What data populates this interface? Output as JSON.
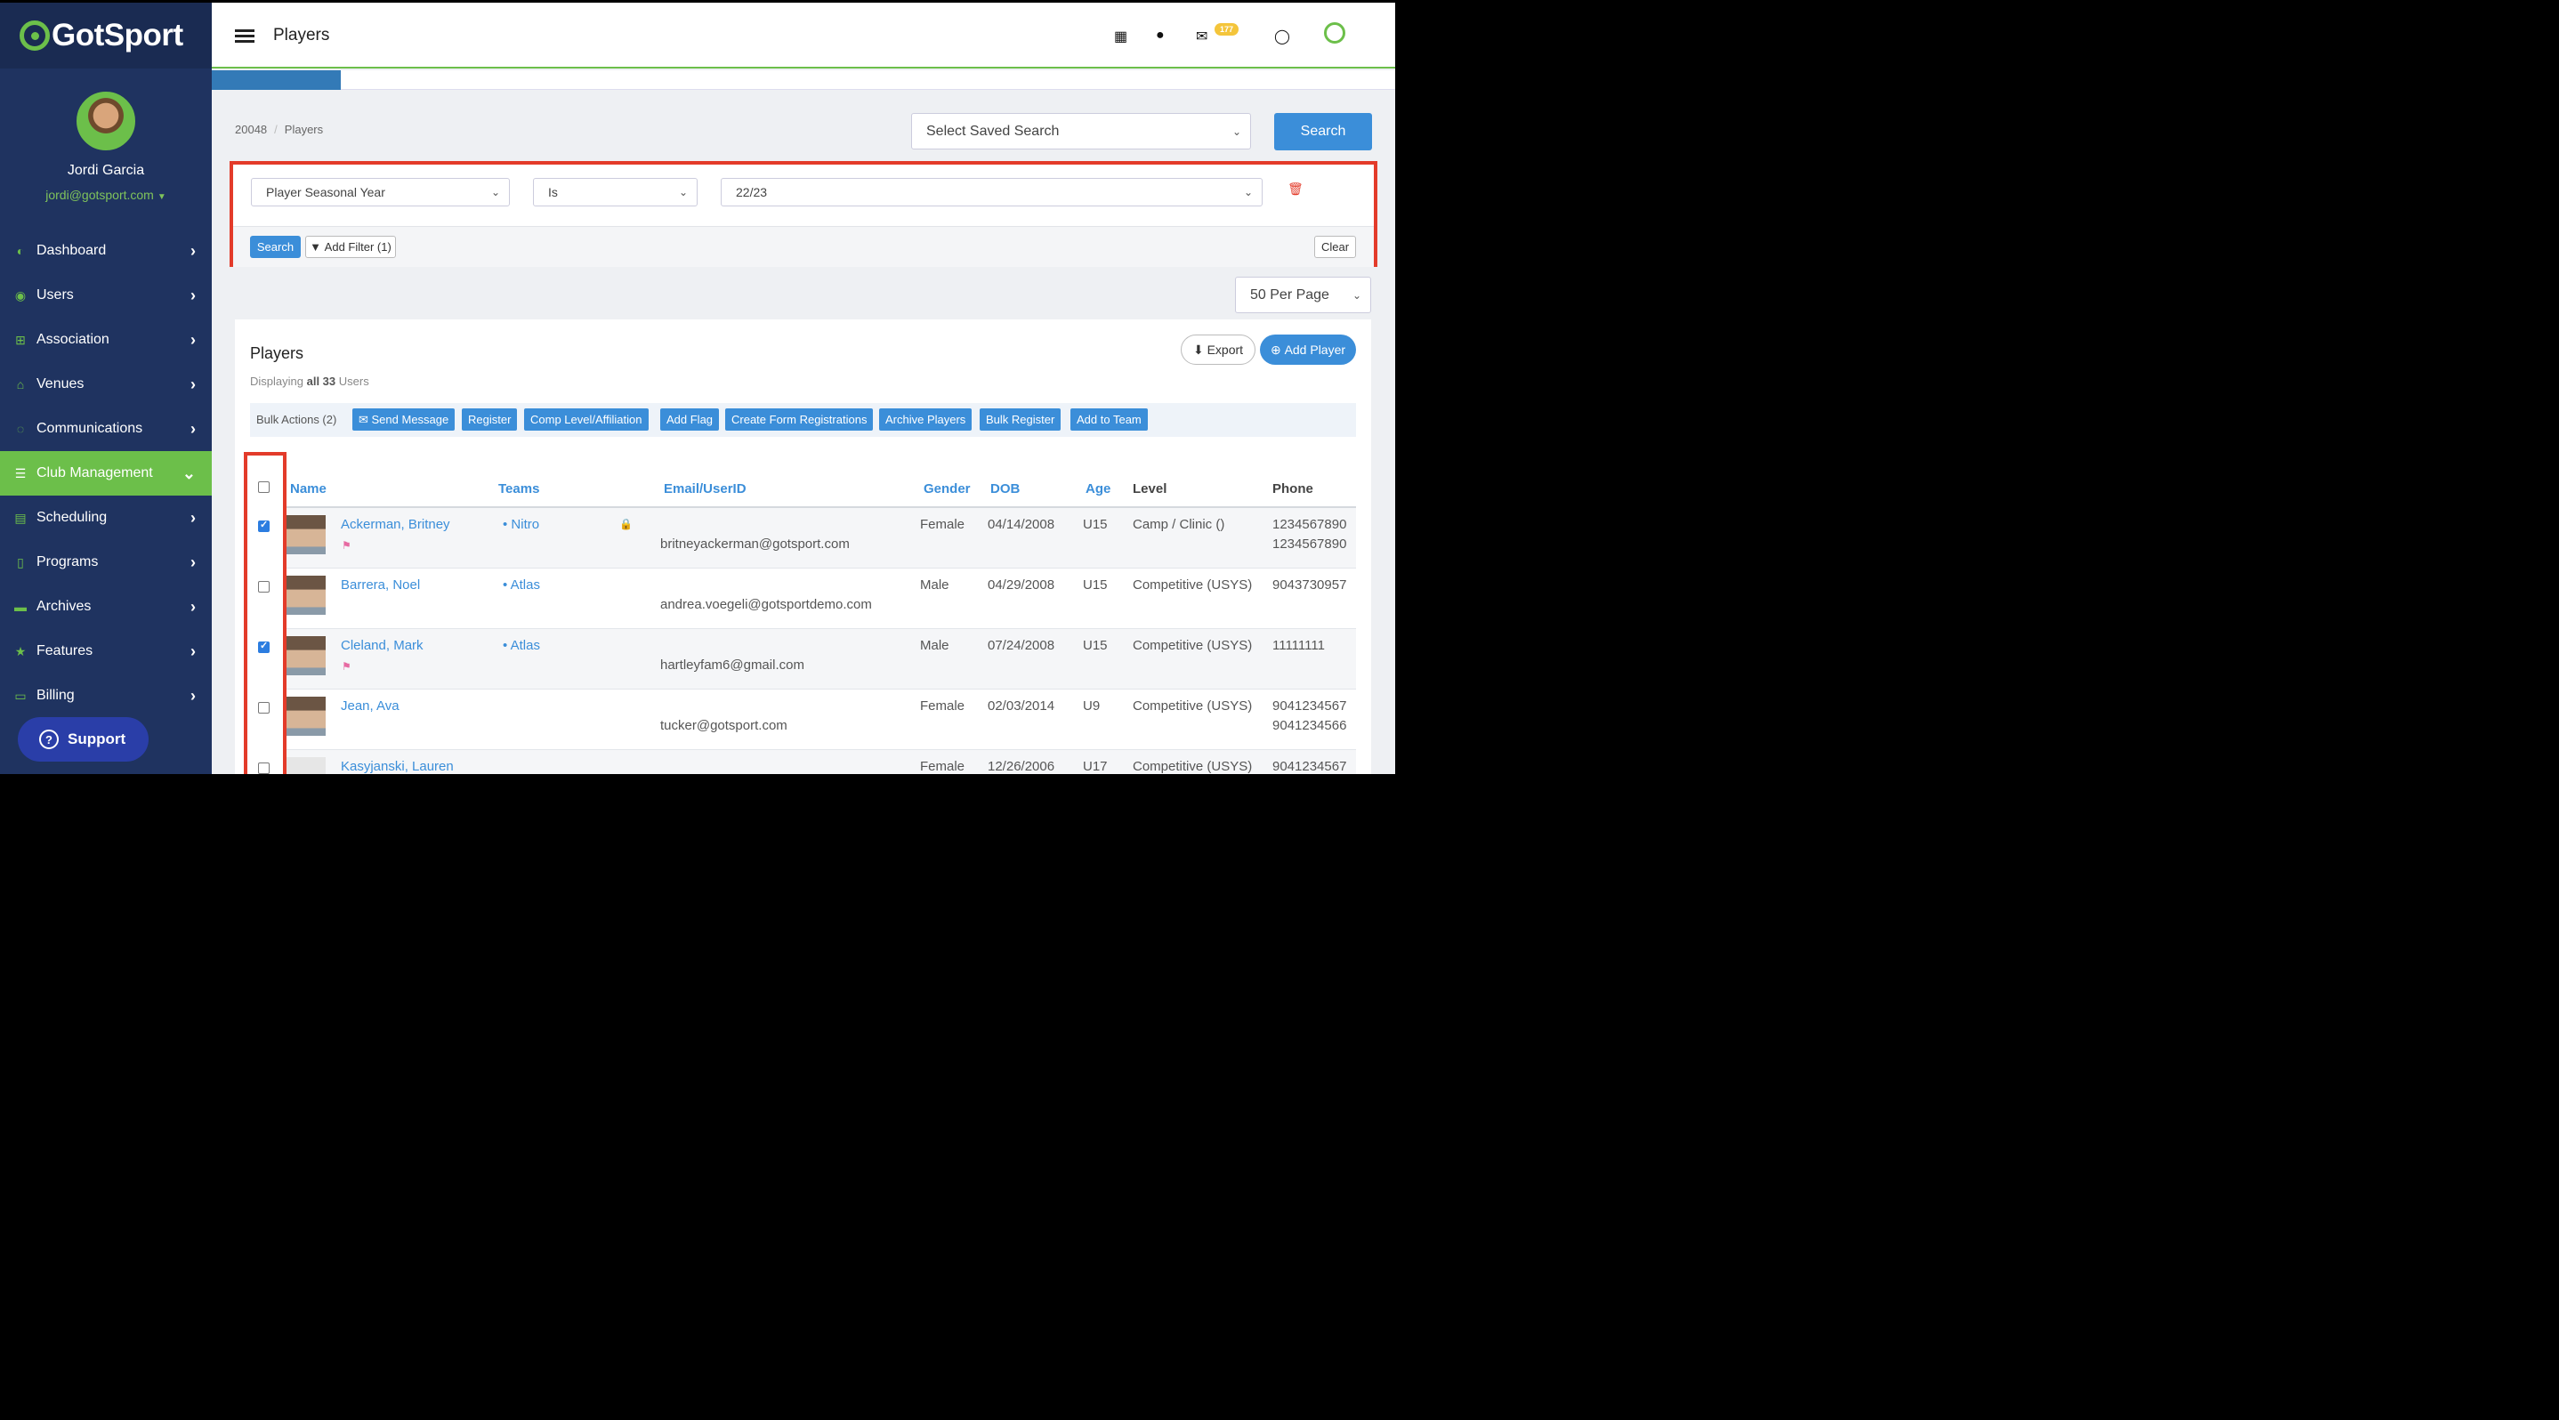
{
  "brand": {
    "logo_text": "GotSport"
  },
  "user": {
    "name": "Jordi Garcia",
    "email": "jordi@gotsport.com"
  },
  "nav": [
    {
      "label": "Dashboard",
      "icon": "dashboard-icon"
    },
    {
      "label": "Users",
      "icon": "users-icon"
    },
    {
      "label": "Association",
      "icon": "sitemap-icon"
    },
    {
      "label": "Venues",
      "icon": "home-icon"
    },
    {
      "label": "Communications",
      "icon": "comments-icon"
    },
    {
      "label": "Club Management",
      "icon": "server-icon",
      "active": true
    },
    {
      "label": "Scheduling",
      "icon": "calendar-icon"
    },
    {
      "label": "Programs",
      "icon": "document-icon"
    },
    {
      "label": "Archives",
      "icon": "archive-icon"
    },
    {
      "label": "Features",
      "icon": "star-icon"
    },
    {
      "label": "Billing",
      "icon": "credit-card-icon"
    }
  ],
  "support_label": "Support",
  "header": {
    "title": "Players",
    "mail_count": "177"
  },
  "breadcrumb": {
    "org": "20048",
    "current": "Players"
  },
  "saved_search": {
    "placeholder": "Select Saved Search",
    "button": "Search"
  },
  "filter": {
    "field": "Player Seasonal Year",
    "operator": "Is",
    "value": "22/23",
    "search_label": "Search",
    "add_filter_label": "Add Filter (1)",
    "clear_label": "Clear"
  },
  "per_page": "50 Per Page",
  "players": {
    "title": "Players",
    "display_prefix": "Displaying",
    "display_all": "all 33",
    "display_suffix": "Users",
    "export_label": "Export",
    "add_label": "Add Player",
    "bulk_label": "Bulk Actions (2)",
    "bulk_actions": [
      "Send Message",
      "Register",
      "Comp Level/Affiliation",
      "Add Flag",
      "Create Form Registrations",
      "Archive Players",
      "Bulk Register",
      "Add to Team"
    ],
    "columns": [
      "Name",
      "Teams",
      "Email/UserID",
      "Gender",
      "DOB",
      "Age",
      "Level",
      "Phone"
    ],
    "rows": [
      {
        "name": "Ackerman, Britney",
        "team": "Nitro",
        "email": "britneyackerman@gotsport.com",
        "gender": "Female",
        "dob": "04/14/2008",
        "age": "U15",
        "level": "Camp / Clinic ()",
        "phone1": "1234567890",
        "phone2": "1234567890",
        "checked": true,
        "flag": true,
        "lock": true
      },
      {
        "name": "Barrera, Noel",
        "team": "Atlas",
        "email": "andrea.voegeli@gotsportdemo.com",
        "gender": "Male",
        "dob": "04/29/2008",
        "age": "U15",
        "level": "Competitive (USYS)",
        "phone1": "9043730957",
        "phone2": "",
        "checked": false
      },
      {
        "name": "Cleland, Mark",
        "team": "Atlas",
        "email": "hartleyfam6@gmail.com",
        "gender": "Male",
        "dob": "07/24/2008",
        "age": "U15",
        "level": "Competitive (USYS)",
        "phone1": "11111111",
        "phone2": "",
        "checked": true,
        "flag": true
      },
      {
        "name": "Jean, Ava",
        "team": "",
        "email": "tucker@gotsport.com",
        "gender": "Female",
        "dob": "02/03/2014",
        "age": "U9",
        "level": "Competitive (USYS)",
        "phone1": "9041234567",
        "phone2": "9041234566",
        "checked": false
      },
      {
        "name": "Kasyjanski, Lauren",
        "team": "",
        "email": "",
        "gender": "Female",
        "dob": "12/26/2006",
        "age": "U17",
        "level": "Competitive (USYS)",
        "phone1": "9041234567",
        "phone2": "",
        "checked": false,
        "placeholder": true
      }
    ]
  }
}
